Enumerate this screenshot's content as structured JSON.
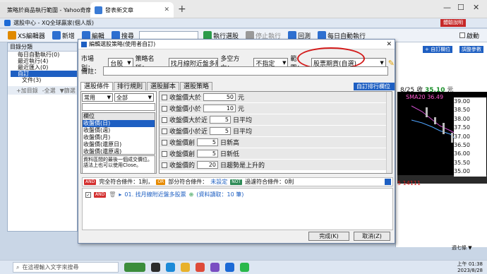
{
  "browser": {
    "tab1_title": "策略於商品執行範圍 - Yahoo奇摩",
    "tab2_title": "發表新文章"
  },
  "app": {
    "title": "選股中心 - XQ全球贏家(個人版)",
    "help_badge": "體驗說明",
    "toolbar": {
      "xs_editor": "XS編輯器",
      "new": "新增",
      "edit": "編輯",
      "search": "搜尋",
      "run": "執行選股",
      "stop": "停止執行",
      "backtest": "回測",
      "daily_run": "每日自動執行",
      "autostart_label": "啟動"
    },
    "left_panel": {
      "title": "目錄分類",
      "items": [
        "每日自動執行(0)",
        "最近執行(4)",
        "最近匯入(0)",
        "自訂",
        "文件(3)"
      ],
      "tools": [
        "+加目錄",
        "-全選",
        "▼篩選"
      ]
    },
    "right_panel": {
      "button1": "+ 自訂欄位",
      "button2": "調整參數"
    }
  },
  "dialog": {
    "title": "編輯選股策略(使用者自訂)",
    "market_label": "市場別：",
    "market_value": "台股",
    "strategy_label": "策略名稱：",
    "strategy_value": "找月線附近盤多股票",
    "direction_label": "多空方向：",
    "direction_value": "不指定",
    "scope_label": "範圍：",
    "scope_value": "股票期貨(自選)",
    "note_label": "備註：",
    "tabs": [
      "選股條件",
      "排行規則",
      "選股腳本",
      "選股策略"
    ],
    "custom_rank_button": "自訂排行欄位 +",
    "filter_common": "常用",
    "filter_all": "全部",
    "fields_header": "欄位",
    "fields": [
      "收盤價(日)",
      "收盤價(週)",
      "收盤價(月)",
      "收盤價(還原日)",
      "收盤價(還原週)"
    ],
    "field_desc": "資料區間的最後一個成交價位。語法上也可以使用Close。",
    "conditions": [
      {
        "label": "收盤價大於",
        "value": "50",
        "unit": "元"
      },
      {
        "label": "收盤價小於",
        "value": "10",
        "unit": "元"
      },
      {
        "label": "收盤價大於近",
        "value": "5",
        "unit": "日平均"
      },
      {
        "label": "收盤價小於近",
        "value": "5",
        "unit": "日平均"
      },
      {
        "label": "收盤價創",
        "value": "5",
        "unit": "日新高"
      },
      {
        "label": "收盤價創",
        "value": "5",
        "unit": "日新低"
      },
      {
        "label": "收盤價的",
        "value": "20",
        "unit": "日趨勢是上升的"
      }
    ],
    "legend": {
      "and_badge": "AND",
      "and_text": "完全符合條件：1則，",
      "or_badge": "OR",
      "or_text": "部分符合條件：",
      "or_value": "未設定",
      "not_badge": "NOT",
      "not_text": "過濾符合條件：0則"
    },
    "result": {
      "badge": "AND",
      "text": "01. 找月線附近盤多股票",
      "data_text": "(資料讀取：10 筆)"
    },
    "ok_button": "完成(K)",
    "cancel_button": "取消(Z)"
  },
  "chart": {
    "date": "8/25",
    "close_label": "收",
    "close_value": "35.10",
    "close_unit": "元",
    "sma_label": "SMA20",
    "sma_value": "36.49",
    "prices": [
      "39.00",
      "38.50",
      "38.00",
      "37.50",
      "37.00",
      "36.50",
      "36.00",
      "35.50",
      "35.00"
    ],
    "volume_label": "5 14111",
    "bottom_text": "週七條 ▼"
  },
  "taskbar": {
    "search_placeholder": "在這裡輸入文字來搜尋",
    "time": "上午 01:38",
    "date": "2023/8/28"
  },
  "colors": {
    "accent": "#1e5fc2",
    "highlight_oval": "#d31b1b",
    "and_badge": "#d32f2f",
    "or_badge": "#e68a00",
    "not_badge": "#2e8b57"
  }
}
